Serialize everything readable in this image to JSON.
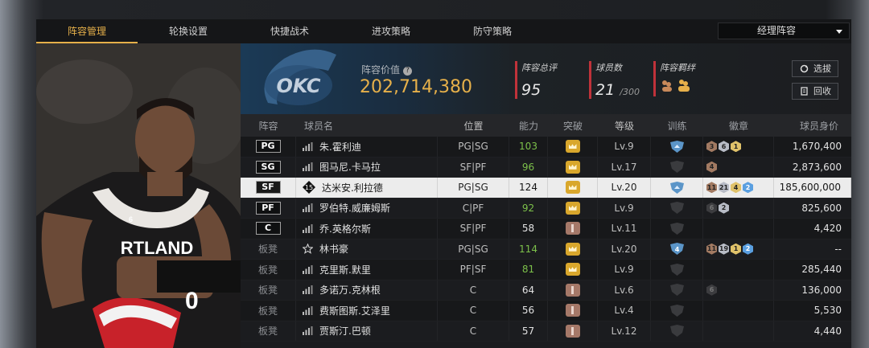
{
  "tabs": [
    "阵容管理",
    "轮换设置",
    "快捷战术",
    "进攻策略",
    "防守策略"
  ],
  "dropdown": {
    "label": "经理阵容"
  },
  "summary": {
    "team_logo_text": "OKC",
    "value_label": "阵容价值",
    "value": "202,714,380",
    "overall_label": "阵容总评",
    "overall": "95",
    "count_label": "球员数",
    "count": "21",
    "count_max": "/300",
    "chem_label": "阵容羁绊",
    "select_label": "选拔",
    "recycle_label": "回收"
  },
  "columns": [
    "阵容",
    "球员名",
    "位置",
    "能力",
    "突破",
    "等级",
    "训练",
    "徽章",
    "球员身价"
  ],
  "rows": [
    {
      "slot": "PG",
      "bench": false,
      "icon": "signal",
      "name": "朱.霍利迪",
      "role": "PG|SG",
      "ability": "103",
      "ab_green": true,
      "breakthrough": "crown",
      "level": "Lv.9",
      "training": "blue",
      "badges": [
        [
          "3",
          "b"
        ],
        [
          "6",
          "s"
        ],
        [
          "1",
          "g"
        ]
      ],
      "value": "1,670,400"
    },
    {
      "slot": "SG",
      "bench": false,
      "icon": "signal",
      "name": "图马尼.卡马拉",
      "role": "SF|PF",
      "ability": "96",
      "ab_green": true,
      "breakthrough": "crown",
      "level": "Lv.17",
      "training": "dark",
      "badges": [
        [
          "4",
          "b"
        ]
      ],
      "value": "2,873,600"
    },
    {
      "slot": "SF",
      "bench": false,
      "icon": "diamond15",
      "name": "达米安.利拉德",
      "role": "PG|SG",
      "ability": "124",
      "ab_green": false,
      "breakthrough": "crown",
      "level": "Lv.20",
      "training": "blue",
      "badges": [
        [
          "11",
          "b"
        ],
        [
          "21",
          "s"
        ],
        [
          "4",
          "g"
        ],
        [
          "2",
          "p"
        ]
      ],
      "value": "185,600,000",
      "selected": true
    },
    {
      "slot": "PF",
      "bench": false,
      "icon": "signal",
      "name": "罗伯特.威廉姆斯",
      "role": "C|PF",
      "ability": "92",
      "ab_green": true,
      "breakthrough": "crown",
      "level": "Lv.9",
      "training": "dark",
      "badges": [
        [
          "6",
          "d"
        ],
        [
          "2",
          "s"
        ]
      ],
      "value": "825,600"
    },
    {
      "slot": "C",
      "bench": false,
      "icon": "signal",
      "name": "乔.英格尔斯",
      "role": "SF|PF",
      "ability": "58",
      "ab_green": false,
      "breakthrough": "lock",
      "level": "Lv.11",
      "training": "dark",
      "badges": [],
      "value": "4,420"
    },
    {
      "slot": "板凳",
      "bench": true,
      "icon": "star",
      "name": "林书豪",
      "role": "PG|SG",
      "ability": "114",
      "ab_green": true,
      "breakthrough": "crown",
      "level": "Lv.20",
      "training": "blue4",
      "badges": [
        [
          "11",
          "b"
        ],
        [
          "19",
          "s"
        ],
        [
          "1",
          "g"
        ],
        [
          "2",
          "p"
        ]
      ],
      "value": "--"
    },
    {
      "slot": "板凳",
      "bench": true,
      "icon": "signal",
      "name": "克里斯.默里",
      "role": "PF|SF",
      "ability": "81",
      "ab_green": true,
      "breakthrough": "crown",
      "level": "Lv.9",
      "training": "dark",
      "badges": [],
      "value": "285,440"
    },
    {
      "slot": "板凳",
      "bench": true,
      "icon": "signal",
      "name": "多诺万.克林根",
      "role": "C",
      "ability": "64",
      "ab_green": false,
      "breakthrough": "lock",
      "level": "Lv.6",
      "training": "dark",
      "badges": [
        [
          "6",
          "d"
        ]
      ],
      "value": "136,000"
    },
    {
      "slot": "板凳",
      "bench": true,
      "icon": "signal",
      "name": "费斯图斯.艾泽里",
      "role": "C",
      "ability": "56",
      "ab_green": false,
      "breakthrough": "lock",
      "level": "Lv.4",
      "training": "dark",
      "badges": [],
      "value": "5,530"
    },
    {
      "slot": "板凳",
      "bench": true,
      "icon": "signal",
      "name": "贾斯汀.巴顿",
      "role": "C",
      "ability": "57",
      "ab_green": false,
      "breakthrough": "lock",
      "level": "Lv.12",
      "training": "dark",
      "badges": [],
      "value": "4,440"
    }
  ],
  "portrait": {
    "jersey_text": "RTLAND",
    "jersey_number": "0",
    "patch_number": "6"
  },
  "colors": {
    "accent": "#e6b04a",
    "green": "#7cc04a",
    "stat_bar": "#c0323a",
    "selected_row": "#ececec"
  }
}
